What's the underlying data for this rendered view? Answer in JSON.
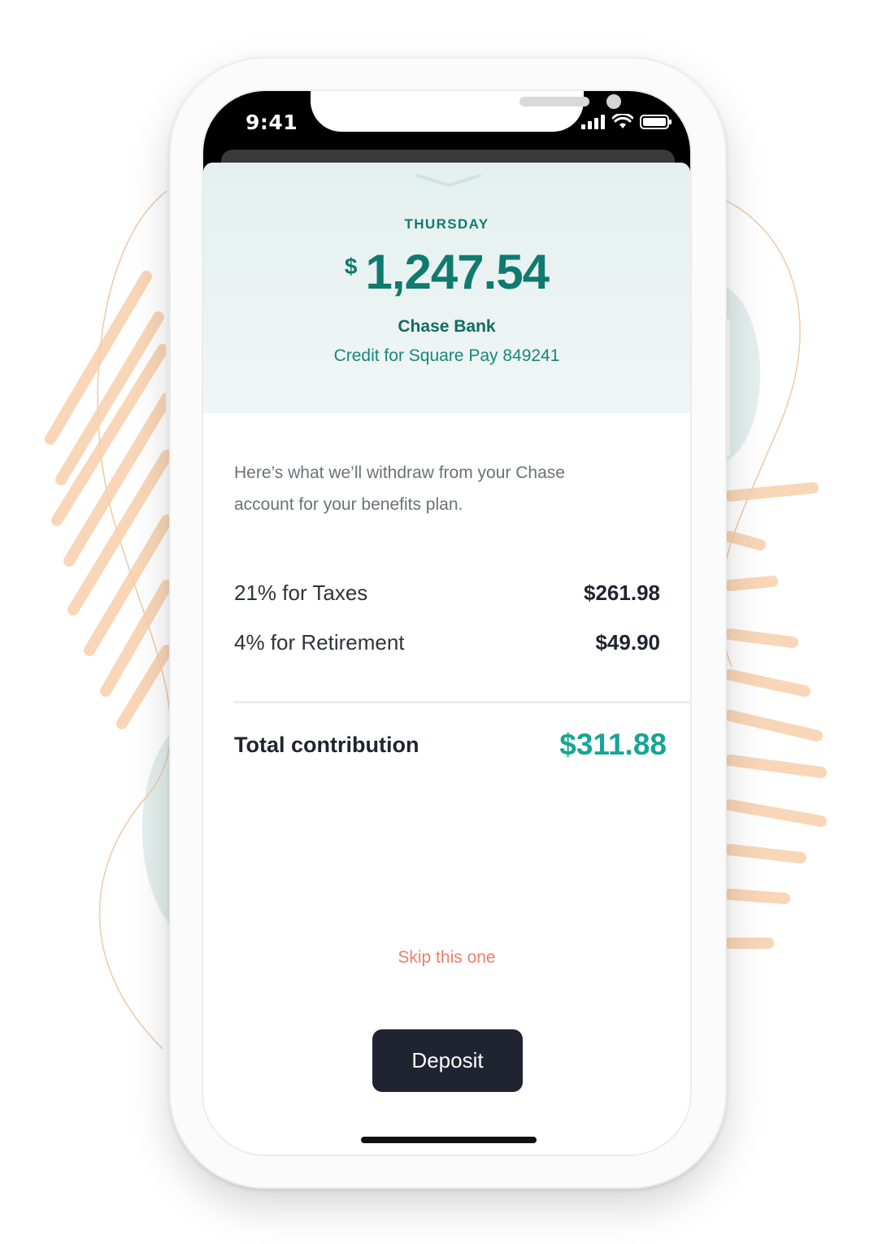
{
  "status_bar": {
    "time": "9:41"
  },
  "header": {
    "day": "THURSDAY",
    "currency_symbol": "$",
    "amount": "1,247.54",
    "bank": "Chase Bank",
    "reference": "Credit for Square Pay 849241"
  },
  "body": {
    "description": "Here’s what we’ll withdraw from your Chase account for your benefits plan.",
    "items": [
      {
        "label": "21% for Taxes",
        "value": "$261.98"
      },
      {
        "label": "4% for Retirement",
        "value": "$49.90"
      }
    ],
    "total": {
      "label": "Total contribution",
      "value": "$311.88"
    }
  },
  "actions": {
    "skip_label": "Skip this one",
    "deposit_label": "Deposit"
  },
  "colors": {
    "accent": "#0f7a6e",
    "total_accent": "#17a594",
    "skip": "#f07d6c",
    "button": "#1f2430",
    "decor_orange": "#f7c79c",
    "decor_teal": "#dfeceb"
  }
}
